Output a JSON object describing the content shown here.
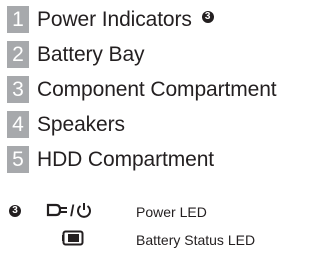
{
  "legend": {
    "items": [
      {
        "number": "1",
        "label": "Power Indicators",
        "marker": "3"
      },
      {
        "number": "2",
        "label": "Battery Bay"
      },
      {
        "number": "3",
        "label": "Component Compartment"
      },
      {
        "number": "4",
        "label": "Speakers"
      },
      {
        "number": "5",
        "label": "HDD Compartment"
      }
    ]
  },
  "note": {
    "marker": "3",
    "power_led": {
      "icons": [
        "ac-power-plug-icon",
        "power-symbol-icon"
      ],
      "separator": "/",
      "label": "Power LED"
    },
    "battery_led": {
      "icon": "battery-icon",
      "label": "Battery Status LED"
    }
  },
  "colors": {
    "number_box": "#a7a9ac",
    "text": "#231f20"
  }
}
